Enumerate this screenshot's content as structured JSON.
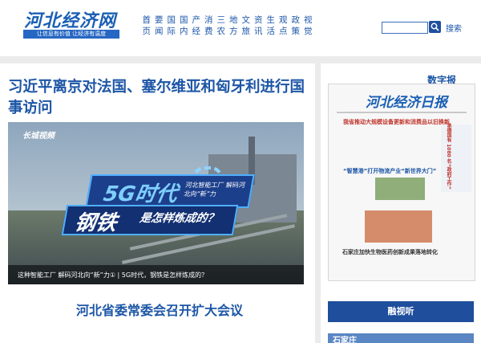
{
  "header": {
    "logo": "河北经济网",
    "slogan": "让信息有价值  让经济有温度",
    "nav_row1": [
      "首",
      "要",
      "国",
      "国",
      "产",
      "消",
      "三",
      "地",
      "文",
      "资",
      "生",
      "观",
      "政",
      "视"
    ],
    "nav_row2": [
      "页",
      "闻",
      "际",
      "内",
      "经",
      "费",
      "农",
      "方",
      "旅",
      "讯",
      "活",
      "点",
      "策",
      "觉"
    ],
    "search_label": "搜索"
  },
  "main": {
    "headline": "习近平离京对法国、塞尔维亚和匈牙利进行国事访问",
    "photo": {
      "tag": "长城视频",
      "overlay_line1": "5G时代",
      "overlay_small": "河北智能工厂 解码河北向“新”力",
      "overlay_line2": "钢铁",
      "overlay_line3": "是怎样炼成的？",
      "caption": "这种智能工厂  解码河北向“新”力① | 5G时代，钢铁是怎样炼成的？"
    },
    "headline2": "河北省委常委会召开扩大会议"
  },
  "sidebar": {
    "label": "数字报",
    "paper": {
      "masthead": "河北经济日报",
      "headline1": "我省推动大规模设备更新和消费品以旧换新",
      "headline2": "“智慧港”打开物流产业“新世界大门”",
      "headline3": "石家庄加快生物医药创新成果落地转化",
      "side_text": "承德国有 1080 名“政府工作”"
    },
    "rtsl": "融视听",
    "thumb": "石家庄"
  }
}
